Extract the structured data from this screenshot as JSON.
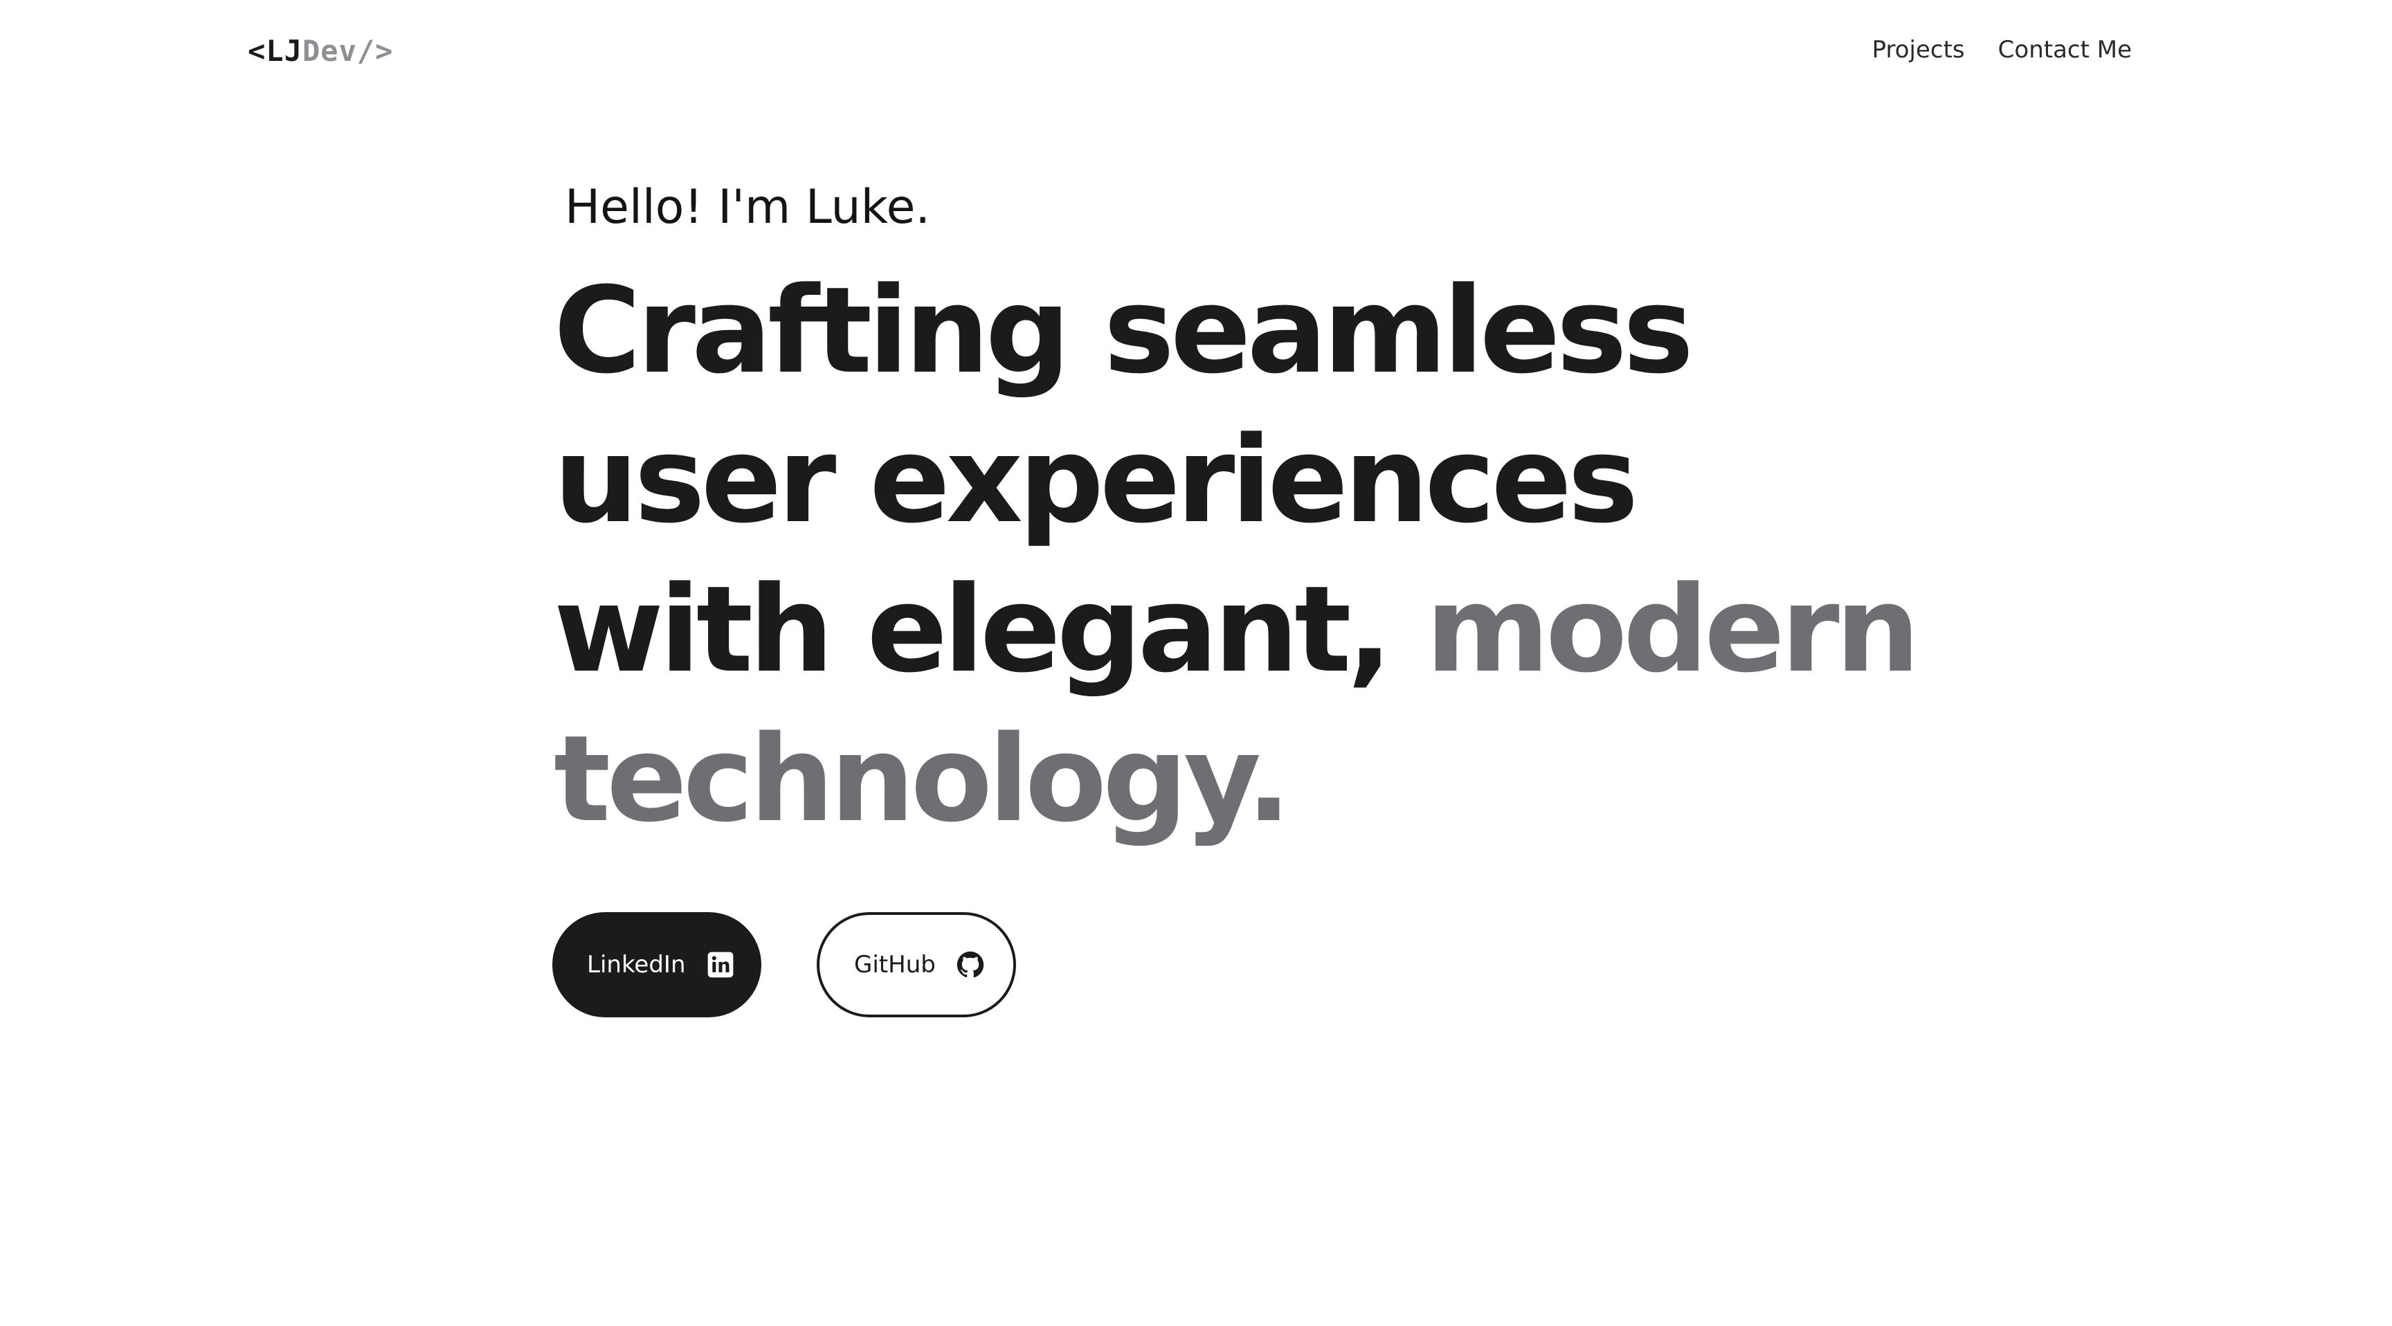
{
  "header": {
    "logo": {
      "open": "<",
      "initials": "LJ",
      "suffix": "Dev/>"
    },
    "nav": {
      "projects": "Projects",
      "contact": "Contact Me"
    }
  },
  "hero": {
    "greeting": "Hello! I'm Luke.",
    "headline": {
      "line1": "Crafting seamless",
      "line2": "user experiences",
      "line3_dark": "with elegant, ",
      "line3_gray": "modern",
      "line4_gray": "technology."
    }
  },
  "buttons": {
    "linkedin": {
      "label": "LinkedIn",
      "icon": "linkedin-icon"
    },
    "github": {
      "label": "GitHub",
      "icon": "github-icon"
    }
  },
  "colors": {
    "primary": "#1b1b1d",
    "accent_gray": "#6e6e73",
    "logo_muted": "#8e8e93",
    "background": "#ffffff"
  }
}
